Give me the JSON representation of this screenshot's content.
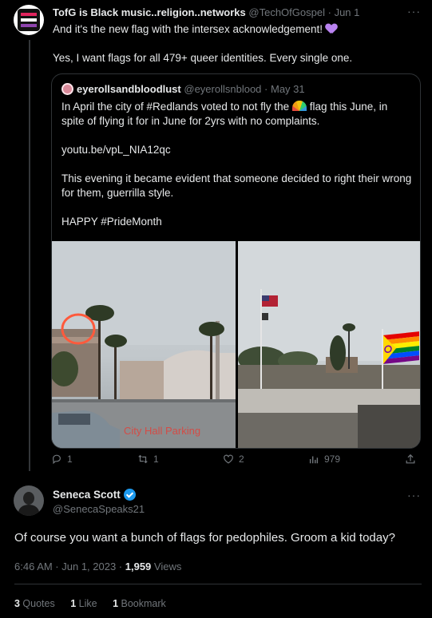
{
  "tweet1": {
    "name": "TofG is Black music..religion..networks",
    "handle": "@TechOfGospel",
    "dot": "·",
    "date": "Jun 1",
    "more": "···",
    "line1": "And it's the new flag with the intersex acknowledgement!",
    "emoji_heart": "purple-heart-icon",
    "line2": "Yes, I want flags for all 479+ queer identities. Every single one."
  },
  "quote": {
    "name": "eyerollsandbloodlust",
    "handle": "@eyerollsnblood",
    "dot": "·",
    "date": "May 31",
    "text_a": "In April the city of  #Redlands voted to not fly the",
    "text_b": "flag this June, in spite of flying it for in June for 2yrs with no complaints.",
    "link": "youtu.be/vpL_NIA12qc",
    "text_c": "This evening it became evident that someone decided to right their wrong for them, guerrilla style.",
    "hashtag": "HAPPY #PrideMonth",
    "photo_caption": "City Hall Parking"
  },
  "actions1": {
    "replies": "1",
    "reposts": "1",
    "likes": "2",
    "views": "979"
  },
  "tweet2": {
    "name": "Seneca Scott",
    "handle": "@SenecaSpeaks21",
    "more": "···",
    "text": "Of course you want a bunch of flags for pedophiles. Groom a kid today?",
    "time": "6:46 AM · Jun 1, 2023 · ",
    "views_count": "1,959",
    "views_label": " Views",
    "quotes_count": "3",
    "quotes_label": " Quotes",
    "likes_count": "1",
    "likes_label": " Like",
    "bookmarks_count": "1",
    "bookmarks_label": " Bookmark"
  },
  "colors": {
    "background": "#000000",
    "text": "#e7e9ea",
    "muted": "#71767b",
    "verified": "#1d9bf0",
    "annotation_red": "#ff5a3c"
  }
}
